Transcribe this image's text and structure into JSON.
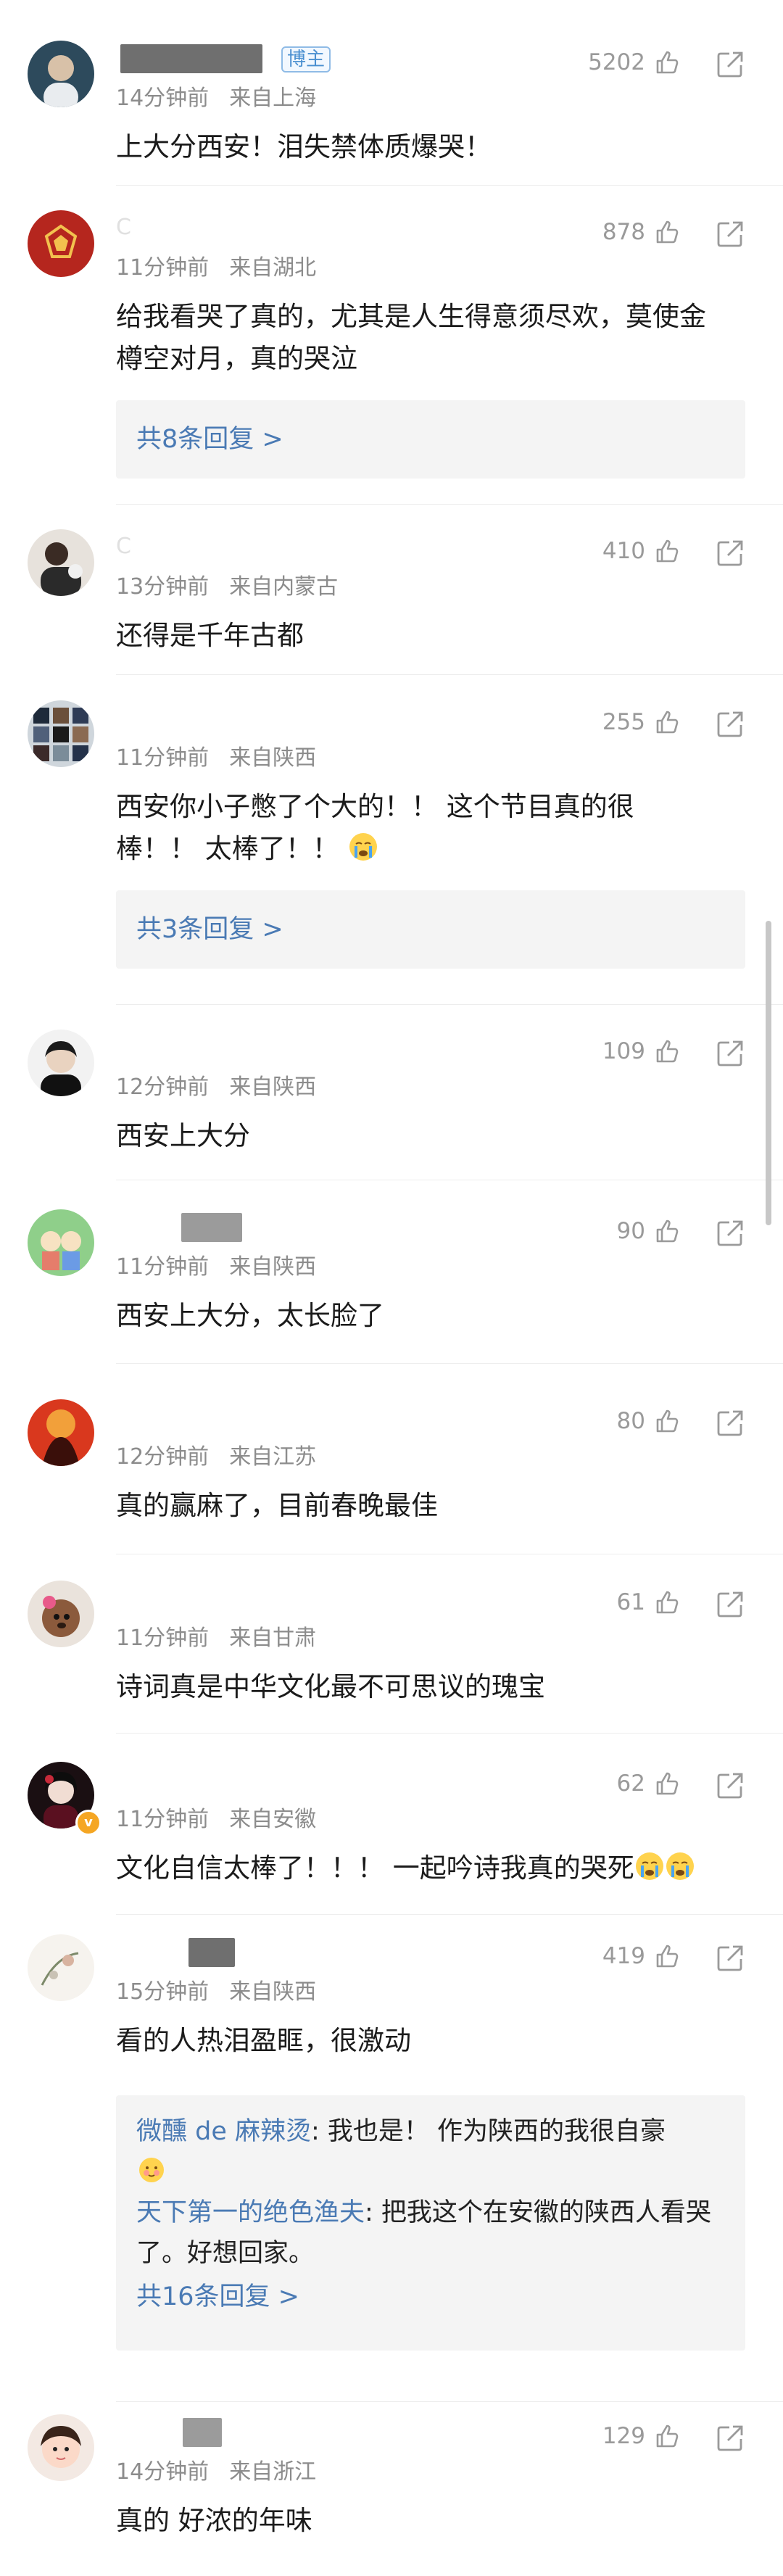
{
  "comments": [
    {
      "user": "",
      "meta_time": "14分钟前",
      "meta_loc": "来自上海",
      "likes": "5202",
      "text": "上大分西安！泪失禁体质爆哭！",
      "badge": "博主"
    },
    {
      "user": "C",
      "meta_time": "11分钟前",
      "meta_loc": "来自湖北",
      "likes": "878",
      "text": "给我看哭了真的，尤其是人生得意须尽欢，莫使金樽空对月，真的哭泣",
      "reply_total": "共8条回复 >"
    },
    {
      "user": "C",
      "meta_time": "13分钟前",
      "meta_loc": "来自内蒙古",
      "likes": "410",
      "text": "还得是千年古都"
    },
    {
      "user": "",
      "meta_time": "11分钟前",
      "meta_loc": "来自陕西",
      "likes": "255",
      "text": "西安你小子憋了个大的！！ 这个节目真的很棒！！ 太棒了！！",
      "reply_total": "共3条回复 >"
    },
    {
      "user": "",
      "meta_time": "12分钟前",
      "meta_loc": "来自陕西",
      "likes": "109",
      "text": "西安上大分"
    },
    {
      "user": "",
      "meta_time": "11分钟前",
      "meta_loc": "来自陕西",
      "likes": "90",
      "text": "西安上大分，太长脸了"
    },
    {
      "user": "",
      "meta_time": "12分钟前",
      "meta_loc": "来自江苏",
      "likes": "80",
      "text": "真的赢麻了，目前春晚最佳"
    },
    {
      "user": "",
      "meta_time": "11分钟前",
      "meta_loc": "来自甘肃",
      "likes": "61",
      "text": "诗词真是中华文化最不可思议的瑰宝"
    },
    {
      "user": "",
      "meta_time": "11分钟前",
      "meta_loc": "来自安徽",
      "likes": "62",
      "text": "文化自信太棒了！！！ 一起吟诗我真的哭死"
    },
    {
      "user": "",
      "meta_time": "15分钟前",
      "meta_loc": "来自陕西",
      "likes": "419",
      "text": "看的人热泪盈眶，很激动",
      "sub_replies": [
        {
          "name": "微醺 de 麻辣烫",
          "text": ": 我也是！ 作为陕西的我很自豪"
        },
        {
          "name": "天下第一的绝色渔夫",
          "text": ": 把我这个在安徽的陕西人看哭了。好想回家。"
        }
      ],
      "reply_total": "共16条回复 >"
    },
    {
      "user": "",
      "meta_time": "14分钟前",
      "meta_loc": "来自浙江",
      "likes": "129",
      "text": "真的 好浓的年味"
    }
  ],
  "icons": {
    "like": "thumbs-up-icon",
    "share": "share-icon",
    "emoji_cry": "crying-face-emoji",
    "emoji_shy": "shy-face-emoji"
  },
  "colors": {
    "link": "#4a7ab4",
    "meta": "#8c8c8c",
    "reply_bg": "#f4f4f4"
  }
}
